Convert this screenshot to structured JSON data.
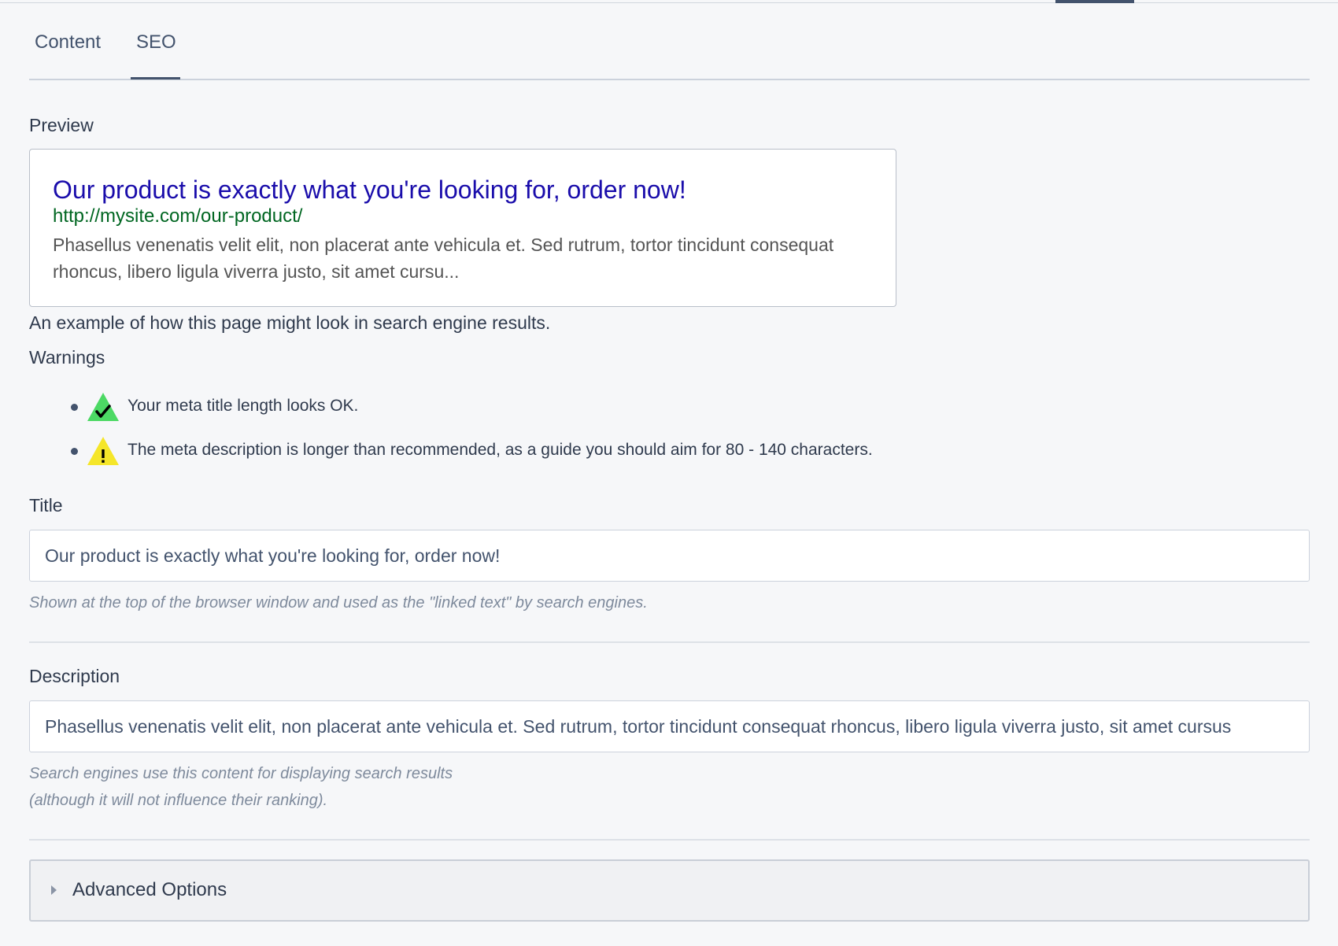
{
  "tabs": [
    {
      "label": "Content",
      "active": false
    },
    {
      "label": "SEO",
      "active": true
    }
  ],
  "preview": {
    "label": "Preview",
    "title": "Our product is exactly what you're looking for, order now!",
    "url": "http://mysite.com/our-product/",
    "description": "Phasellus venenatis velit elit, non placerat ante vehicula et. Sed rutrum, tortor tincidunt consequat rhoncus, libero ligula viverra justo, sit amet cursu...",
    "help": "An example of how this page might look in search engine results."
  },
  "warnings": {
    "label": "Warnings",
    "items": [
      {
        "icon": "check-icon",
        "status": "ok",
        "color": "#4cd964",
        "text": "Your meta title length looks OK."
      },
      {
        "icon": "warning-icon",
        "status": "warning",
        "color": "#f5e62a",
        "text": "The meta description is longer than recommended, as a guide you should aim for 80 - 140 characters."
      }
    ]
  },
  "title_field": {
    "label": "Title",
    "value": "Our product is exactly what you're looking for, order now!",
    "help": "Shown at the top of the browser window and used as the \"linked text\" by search engines."
  },
  "description_field": {
    "label": "Description",
    "value": "Phasellus venenatis velit elit, non placerat ante vehicula et. Sed rutrum, tortor tincidunt consequat rhoncus, libero ligula viverra justo, sit amet cursus",
    "help_line1": "Search engines use this content for displaying search results",
    "help_line2": "(although it will not influence their ranking)."
  },
  "advanced": {
    "label": "Advanced Options",
    "icon": "caret-right-icon",
    "expanded": false
  },
  "colors": {
    "background": "#f6f7f9",
    "text": "#43536d",
    "link_title": "#1a0dab",
    "link_url": "#006621"
  }
}
